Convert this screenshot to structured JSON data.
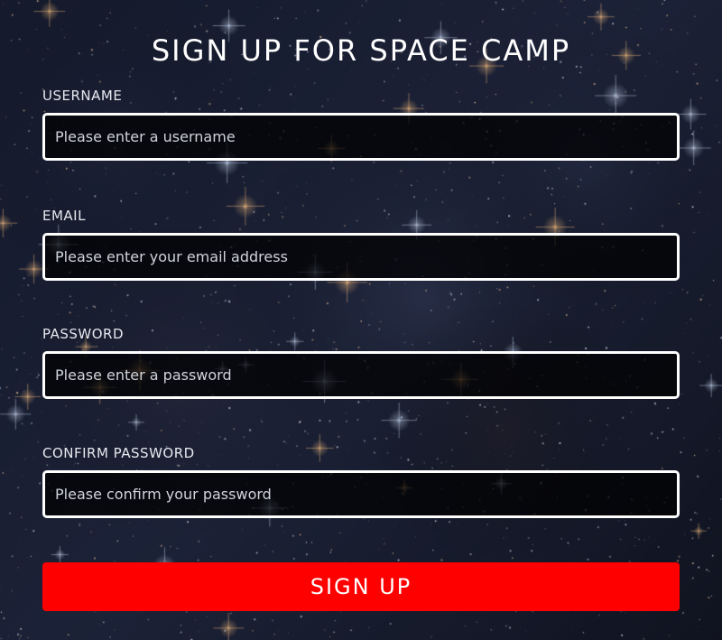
{
  "form": {
    "title": "SIGN UP FOR SPACE CAMP",
    "fields": [
      {
        "label": "USERNAME",
        "placeholder": "Please enter a username",
        "value": ""
      },
      {
        "label": "EMAIL",
        "placeholder": "Please enter your email address",
        "value": ""
      },
      {
        "label": "PASSWORD",
        "placeholder": "Please enter a password",
        "value": ""
      },
      {
        "label": "CONFIRM PASSWORD",
        "placeholder": "Please confirm your password",
        "value": ""
      }
    ],
    "submit_label": "SIGN UP"
  },
  "colors": {
    "button": "#ff0000",
    "field_border": "#ffffff",
    "background": "#14192a"
  }
}
